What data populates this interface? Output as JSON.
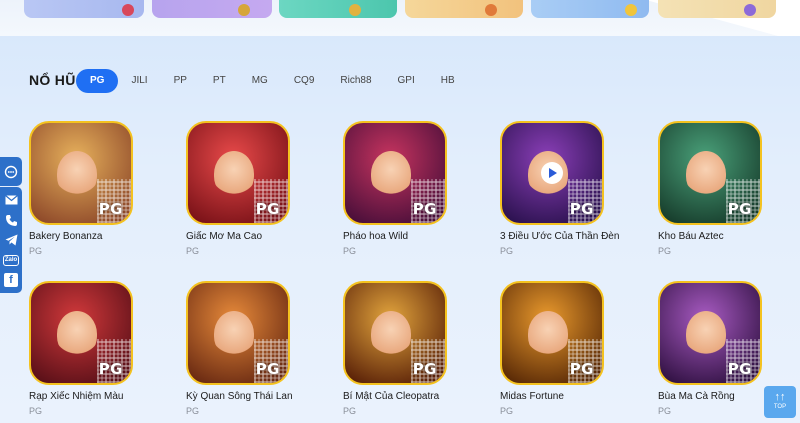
{
  "category": {
    "title": "NỔ HŨ"
  },
  "tabs": [
    {
      "label": "PG",
      "active": true
    },
    {
      "label": "JILI"
    },
    {
      "label": "PP"
    },
    {
      "label": "PT"
    },
    {
      "label": "MG"
    },
    {
      "label": "CQ9"
    },
    {
      "label": "Rich88"
    },
    {
      "label": "GPI"
    },
    {
      "label": "HB"
    }
  ],
  "social_rail": {
    "icons": [
      "chat-bubble-icon",
      "mail-icon",
      "phone-icon",
      "telegram-icon",
      "zalo-icon",
      "facebook-icon"
    ],
    "zalo_text": "Zalo",
    "facebook_text": "f"
  },
  "games": [
    {
      "name": "Bakery Bonanza",
      "provider": "PG",
      "badge": "PG",
      "colors": [
        "#e7b15c",
        "#8f4a2a"
      ]
    },
    {
      "name": "Giấc Mơ Ma Cao",
      "provider": "PG",
      "badge": "PG",
      "colors": [
        "#e94a4a",
        "#7a1218"
      ]
    },
    {
      "name": "Pháo hoa Wild",
      "provider": "PG",
      "badge": "PG",
      "colors": [
        "#c7345f",
        "#4a0f3a"
      ]
    },
    {
      "name": "3 Điều Ước Của Thần Đèn",
      "provider": "PG",
      "badge": "PG",
      "colors": [
        "#8b3fb8",
        "#2c1250"
      ]
    },
    {
      "name": "Kho Báu Aztec",
      "provider": "PG",
      "badge": "PG",
      "colors": [
        "#4aa17a",
        "#173d2c"
      ]
    },
    {
      "name": "Rạp Xiếc Nhiệm Màu",
      "provider": "PG",
      "badge": "PG",
      "colors": [
        "#d2393b",
        "#5a1018"
      ]
    },
    {
      "name": "Kỳ Quan Sông Thái Lan",
      "provider": "PG",
      "badge": "PG",
      "colors": [
        "#e78a3a",
        "#6a2a12"
      ]
    },
    {
      "name": "Bí Mật Của Cleopatra",
      "provider": "PG",
      "badge": "PG",
      "colors": [
        "#e3a53d",
        "#5b2208"
      ]
    },
    {
      "name": "Midas Fortune",
      "provider": "PG",
      "badge": "PG",
      "colors": [
        "#ea9a2d",
        "#5a2a06"
      ]
    },
    {
      "name": "Bùa Ma Cà Rồng",
      "provider": "PG",
      "badge": "PG",
      "colors": [
        "#a85bc2",
        "#321244"
      ]
    }
  ],
  "top_button": {
    "arrow": "↑↑",
    "label": "TOP"
  }
}
